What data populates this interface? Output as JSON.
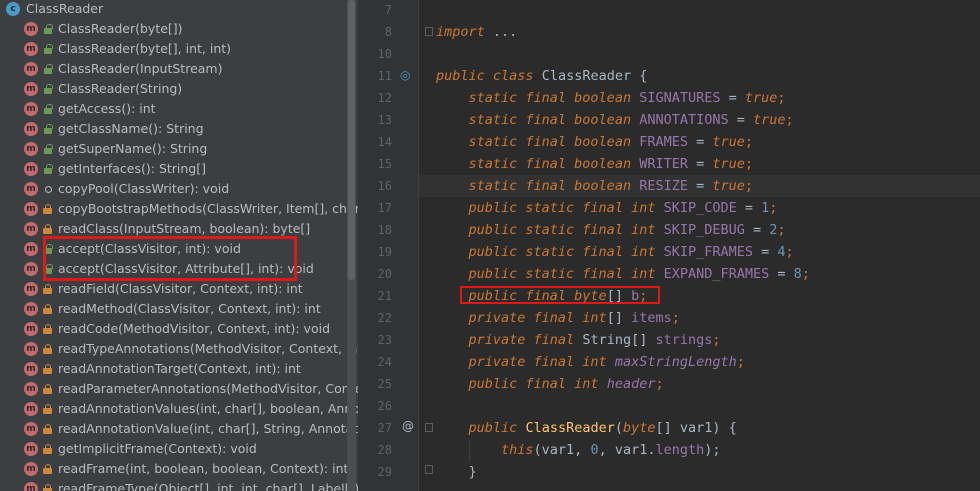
{
  "structure": {
    "root": {
      "label": "ClassReader",
      "badge": "c"
    },
    "method_badge": "m",
    "items": [
      {
        "label": "ClassReader(byte[])",
        "visibility": "public"
      },
      {
        "label": "ClassReader(byte[], int, int)",
        "visibility": "public"
      },
      {
        "label": "ClassReader(InputStream)",
        "visibility": "public"
      },
      {
        "label": "ClassReader(String)",
        "visibility": "public"
      },
      {
        "label": "getAccess(): int",
        "visibility": "public"
      },
      {
        "label": "getClassName(): String",
        "visibility": "public"
      },
      {
        "label": "getSuperName(): String",
        "visibility": "public"
      },
      {
        "label": "getInterfaces(): String[]",
        "visibility": "public"
      },
      {
        "label": "copyPool(ClassWriter): void",
        "visibility": "package"
      },
      {
        "label": "copyBootstrapMethods(ClassWriter, Item[], char[]): v",
        "visibility": "private"
      },
      {
        "label": "readClass(InputStream, boolean): byte[]",
        "visibility": "private"
      },
      {
        "label": "accept(ClassVisitor, int): void",
        "visibility": "public"
      },
      {
        "label": "accept(ClassVisitor, Attribute[], int): void",
        "visibility": "public"
      },
      {
        "label": "readField(ClassVisitor, Context, int): int",
        "visibility": "private"
      },
      {
        "label": "readMethod(ClassVisitor, Context, int): int",
        "visibility": "private"
      },
      {
        "label": "readCode(MethodVisitor, Context, int): void",
        "visibility": "private"
      },
      {
        "label": "readTypeAnnotations(MethodVisitor, Context, int, b",
        "visibility": "private"
      },
      {
        "label": "readAnnotationTarget(Context, int): int",
        "visibility": "private"
      },
      {
        "label": "readParameterAnnotations(MethodVisitor, Context,",
        "visibility": "private"
      },
      {
        "label": "readAnnotationValues(int, char[], boolean, Annotatio",
        "visibility": "private"
      },
      {
        "label": "readAnnotationValue(int, char[], String, AnnotationV",
        "visibility": "private"
      },
      {
        "label": "getImplicitFrame(Context): void",
        "visibility": "private"
      },
      {
        "label": "readFrame(int, boolean, boolean, Context): int",
        "visibility": "private"
      },
      {
        "label": "readFrameType(Object[], int, int, char[], Label[]): int",
        "visibility": "private"
      }
    ]
  },
  "editor": {
    "lines": [
      {
        "n": "7",
        "tokens": []
      },
      {
        "n": "8",
        "tokens": [
          {
            "t": "import",
            "c": "kw"
          },
          {
            "t": " ",
            "c": ""
          },
          {
            "t": "...",
            "c": "cls"
          }
        ]
      },
      {
        "n": "10",
        "tokens": []
      },
      {
        "n": "11",
        "tokens": [
          {
            "t": "public",
            "c": "kw"
          },
          {
            "t": " ",
            "c": ""
          },
          {
            "t": "class",
            "c": "kw"
          },
          {
            "t": " ClassReader {",
            "c": "cls"
          }
        ]
      },
      {
        "n": "12",
        "tokens": [
          {
            "t": "    ",
            "c": ""
          },
          {
            "t": "static final boolean",
            "c": "kw"
          },
          {
            "t": " SIGNATURES",
            "c": "fld"
          },
          {
            "t": " = ",
            "c": ""
          },
          {
            "t": "true",
            "c": "kw"
          },
          {
            "t": ";",
            "c": "kwp"
          }
        ]
      },
      {
        "n": "13",
        "tokens": [
          {
            "t": "    ",
            "c": ""
          },
          {
            "t": "static final boolean",
            "c": "kw"
          },
          {
            "t": " ANNOTATIONS",
            "c": "fld"
          },
          {
            "t": " = ",
            "c": ""
          },
          {
            "t": "true",
            "c": "kw"
          },
          {
            "t": ";",
            "c": "kwp"
          }
        ]
      },
      {
        "n": "14",
        "tokens": [
          {
            "t": "    ",
            "c": ""
          },
          {
            "t": "static final boolean",
            "c": "kw"
          },
          {
            "t": " FRAMES",
            "c": "fld"
          },
          {
            "t": " = ",
            "c": ""
          },
          {
            "t": "true",
            "c": "kw"
          },
          {
            "t": ";",
            "c": "kwp"
          }
        ]
      },
      {
        "n": "15",
        "tokens": [
          {
            "t": "    ",
            "c": ""
          },
          {
            "t": "static final boolean",
            "c": "kw"
          },
          {
            "t": " WRITER",
            "c": "fld"
          },
          {
            "t": " = ",
            "c": ""
          },
          {
            "t": "true",
            "c": "kw"
          },
          {
            "t": ";",
            "c": "kwp"
          }
        ]
      },
      {
        "n": "16",
        "tokens": [
          {
            "t": "    ",
            "c": ""
          },
          {
            "t": "static final boolean",
            "c": "kw"
          },
          {
            "t": " RESIZE",
            "c": "fld"
          },
          {
            "t": " = ",
            "c": ""
          },
          {
            "t": "true",
            "c": "kw"
          },
          {
            "t": ";",
            "c": "kwp"
          }
        ]
      },
      {
        "n": "17",
        "tokens": [
          {
            "t": "    ",
            "c": ""
          },
          {
            "t": "public static final int",
            "c": "kw"
          },
          {
            "t": " SKIP_CODE",
            "c": "fld"
          },
          {
            "t": " = ",
            "c": ""
          },
          {
            "t": "1",
            "c": "num"
          },
          {
            "t": ";",
            "c": "kwp"
          }
        ]
      },
      {
        "n": "18",
        "tokens": [
          {
            "t": "    ",
            "c": ""
          },
          {
            "t": "public static final int",
            "c": "kw"
          },
          {
            "t": " SKIP_DEBUG",
            "c": "fld"
          },
          {
            "t": " = ",
            "c": ""
          },
          {
            "t": "2",
            "c": "num"
          },
          {
            "t": ";",
            "c": "kwp"
          }
        ]
      },
      {
        "n": "19",
        "tokens": [
          {
            "t": "    ",
            "c": ""
          },
          {
            "t": "public static final int",
            "c": "kw"
          },
          {
            "t": " SKIP_FRAMES",
            "c": "fld"
          },
          {
            "t": " = ",
            "c": ""
          },
          {
            "t": "4",
            "c": "num"
          },
          {
            "t": ";",
            "c": "kwp"
          }
        ]
      },
      {
        "n": "20",
        "tokens": [
          {
            "t": "    ",
            "c": ""
          },
          {
            "t": "public static final int",
            "c": "kw"
          },
          {
            "t": " EXPAND_FRAMES",
            "c": "fld"
          },
          {
            "t": " = ",
            "c": ""
          },
          {
            "t": "8",
            "c": "num"
          },
          {
            "t": ";",
            "c": "kwp"
          }
        ]
      },
      {
        "n": "21",
        "tokens": [
          {
            "t": "    ",
            "c": ""
          },
          {
            "t": "public final byte",
            "c": "kw"
          },
          {
            "t": "[] ",
            "c": ""
          },
          {
            "t": "b",
            "c": "fld"
          },
          {
            "t": ";",
            "c": "kwp"
          }
        ]
      },
      {
        "n": "22",
        "tokens": [
          {
            "t": "    ",
            "c": ""
          },
          {
            "t": "private final int",
            "c": "kw"
          },
          {
            "t": "[] ",
            "c": ""
          },
          {
            "t": "items",
            "c": "fld"
          },
          {
            "t": ";",
            "c": "kwp"
          }
        ]
      },
      {
        "n": "23",
        "tokens": [
          {
            "t": "    ",
            "c": ""
          },
          {
            "t": "private final",
            "c": "kw"
          },
          {
            "t": " String[] ",
            "c": ""
          },
          {
            "t": "strings",
            "c": "fld"
          },
          {
            "t": ";",
            "c": "kwp"
          }
        ]
      },
      {
        "n": "24",
        "tokens": [
          {
            "t": "    ",
            "c": ""
          },
          {
            "t": "private final int",
            "c": "kw"
          },
          {
            "t": " maxStringLength",
            "c": "fldi"
          },
          {
            "t": ";",
            "c": "kwp"
          }
        ]
      },
      {
        "n": "25",
        "tokens": [
          {
            "t": "    ",
            "c": ""
          },
          {
            "t": "public final int",
            "c": "kw"
          },
          {
            "t": " header",
            "c": "fldi"
          },
          {
            "t": ";",
            "c": "kwp"
          }
        ]
      },
      {
        "n": "26",
        "tokens": []
      },
      {
        "n": "27",
        "tokens": [
          {
            "t": "    ",
            "c": ""
          },
          {
            "t": "public",
            "c": "kw"
          },
          {
            "t": " ",
            "c": ""
          },
          {
            "t": "ClassReader",
            "c": "fn"
          },
          {
            "t": "(",
            "c": ""
          },
          {
            "t": "byte",
            "c": "kw"
          },
          {
            "t": "[] var1) {",
            "c": ""
          }
        ]
      },
      {
        "n": "28",
        "tokens": [
          {
            "t": "        ",
            "c": ""
          },
          {
            "t": "this",
            "c": "kw"
          },
          {
            "t": "(var1, ",
            "c": ""
          },
          {
            "t": "0",
            "c": "num"
          },
          {
            "t": ", var1.",
            "c": ""
          },
          {
            "t": "length",
            "c": "fld"
          },
          {
            "t": ");",
            "c": ""
          }
        ]
      },
      {
        "n": "29",
        "tokens": [
          {
            "t": "    }",
            "c": ""
          }
        ]
      }
    ]
  },
  "gutter": {
    "override_icon": "implementation-icon",
    "annotation_marker": "@",
    "colors": {
      "background": "#2b2b2b",
      "panel": "#3c3f41",
      "highlight": "#e01818",
      "keyword": "#cc7832",
      "field": "#9876aa",
      "number": "#6897bb"
    }
  }
}
